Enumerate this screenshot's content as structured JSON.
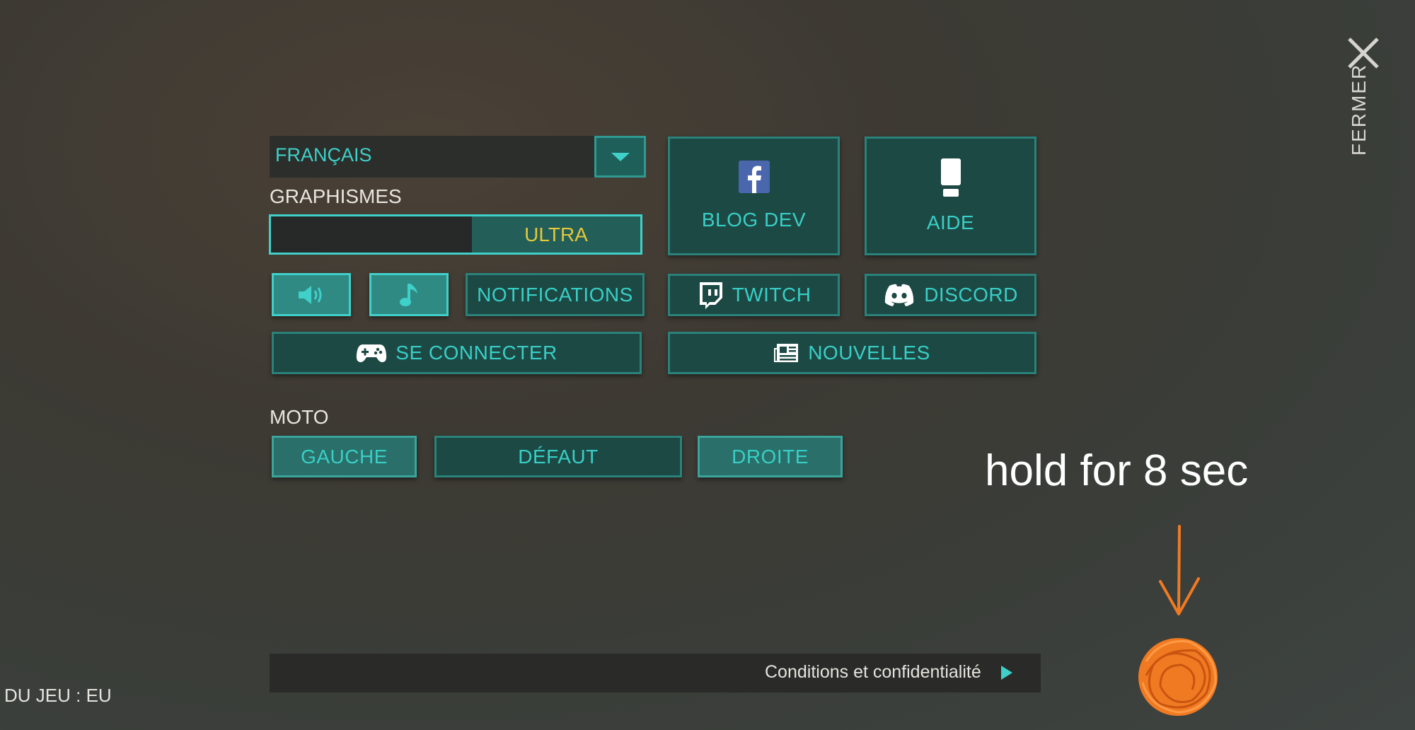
{
  "language": {
    "selected": "FRANÇAIS"
  },
  "graphics": {
    "label": "GRAPHISMES",
    "value": "ULTRA",
    "level": 1.0
  },
  "buttons": {
    "blog": "BLOG DEV",
    "help": "AIDE",
    "notifications": "NOTIFICATIONS",
    "twitch": "TWITCH",
    "discord": "DISCORD",
    "connect": "SE CONNECTER",
    "news": "NOUVELLES"
  },
  "moto": {
    "label": "MOTO",
    "left": "GAUCHE",
    "default": "DÉFAUT",
    "right": "DROITE"
  },
  "footer": {
    "terms": "Conditions et confidentialité",
    "server": "DU JEU : EU"
  },
  "close": {
    "label": "FERMER"
  },
  "annotation": {
    "text": "hold for 8 sec"
  },
  "colors": {
    "accent": "#3fd0c9",
    "button_bg": "#1d4945",
    "highlight": "#e3c83a",
    "annotation": "#f07a22"
  },
  "icons": [
    "caret-down-icon",
    "facebook-icon",
    "help-tube-icon",
    "speaker-icon",
    "music-note-icon",
    "twitch-icon",
    "discord-icon",
    "gamepad-icon",
    "newspaper-icon",
    "play-arrow-icon",
    "close-icon"
  ]
}
